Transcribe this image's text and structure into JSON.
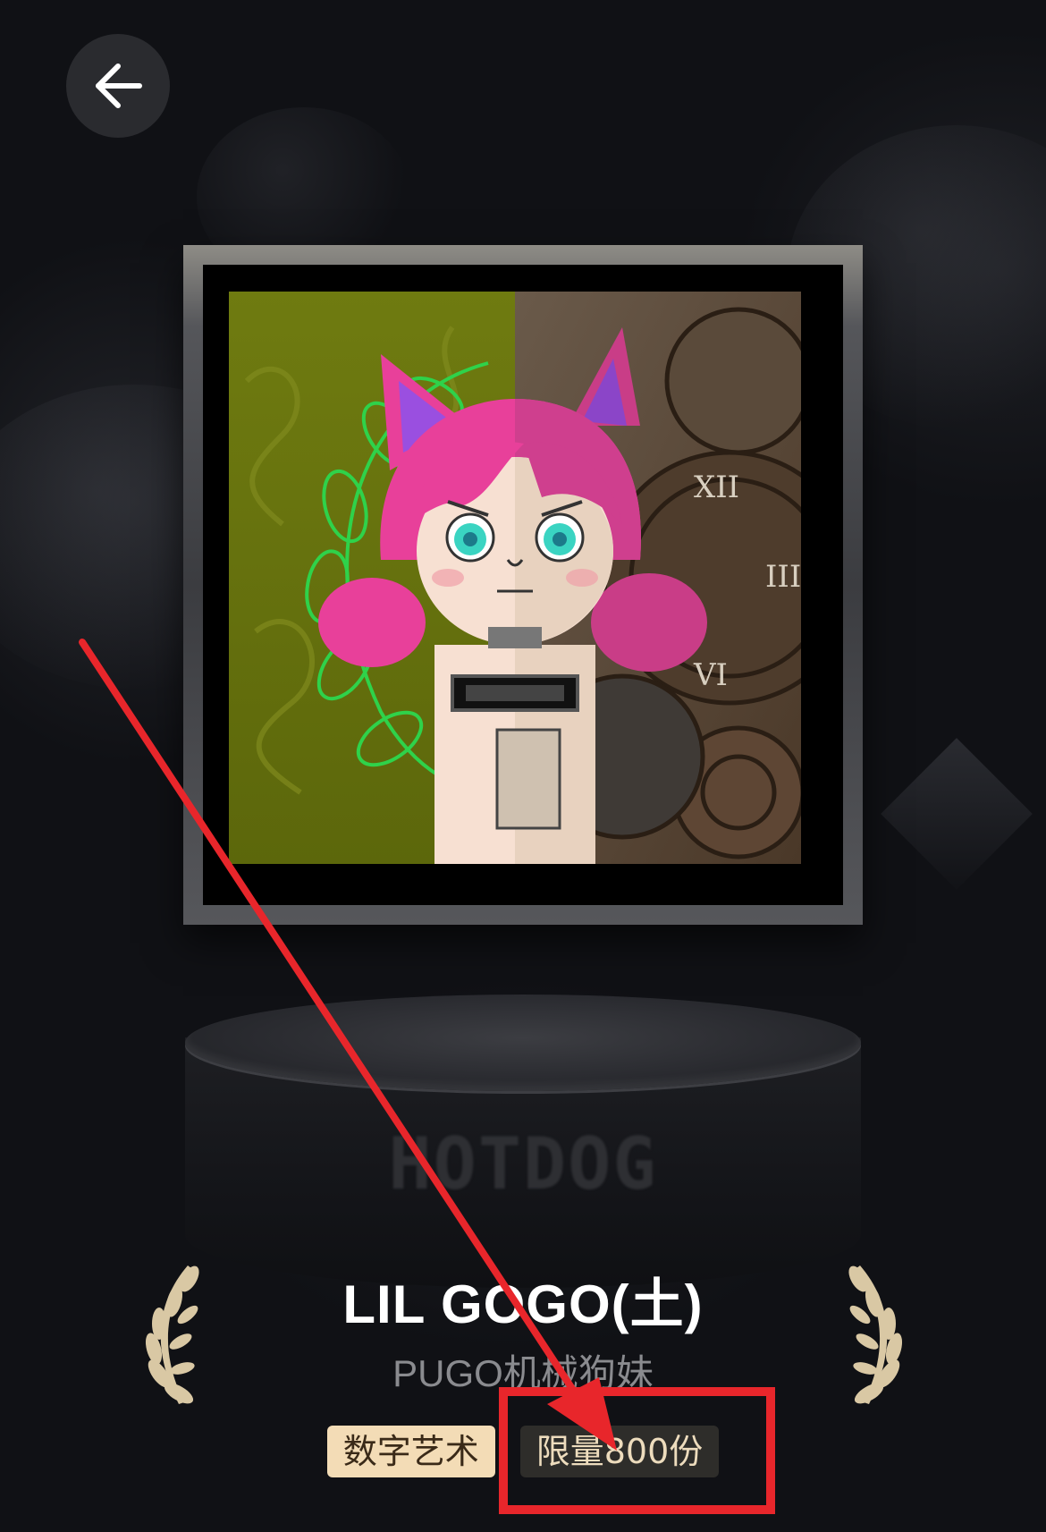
{
  "header": {
    "back_icon": "arrow-left-icon"
  },
  "artwork": {
    "image_description": "pink-haired anime girl with cat ears, half green leafy background, half clockwork background",
    "colors": {
      "left_bg": "#6e7a10",
      "right_bg": "#5a4636",
      "hair": "#e8409a",
      "ear_inner": "#9a4fe0",
      "eyes": "#3ad4c2",
      "laurel_stroke": "#2fd24a"
    }
  },
  "pedestal": {
    "brand_text": "HOTDOG"
  },
  "product": {
    "title": "LIL GOGO(土)",
    "subtitle": "PUGO机械狗妹",
    "tags": {
      "category": "数字艺术",
      "limit": "限量800份"
    }
  },
  "decor": {
    "laurel_color": "#d9c8a4",
    "annotation_color": "#e8262b"
  }
}
